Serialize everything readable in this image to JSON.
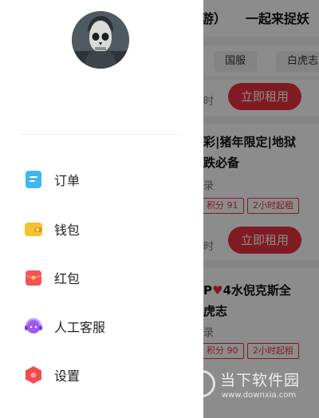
{
  "background": {
    "top_left_fragment": "游）",
    "top_right_title": "一起来捉妖",
    "chips": [
      "国服",
      "白虎志"
    ],
    "cards": [
      {
        "price_suffix": "时",
        "rent_label": "立即租用"
      },
      {
        "title_line1": "彩|猪年限定|地狱",
        "title_line2": "跌必备",
        "subtitle": "录",
        "tag_points": "积分 91",
        "tag_duration": "2小时起租",
        "price_suffix": "时",
        "rent_label": "立即租用"
      },
      {
        "title_prefix": "P",
        "title_after_heart": "4水倪克斯全",
        "title_line2": "虎志",
        "subtitle": "录",
        "tag_points": "积分 90",
        "tag_duration": "2小时起租"
      }
    ]
  },
  "drawer": {
    "menu": [
      {
        "label": "订单",
        "icon": "order-icon",
        "color": "#3fb6f2"
      },
      {
        "label": "钱包",
        "icon": "wallet-icon",
        "color": "#f6c02e"
      },
      {
        "label": "红包",
        "icon": "red-packet-icon",
        "color": "#f25353"
      },
      {
        "label": "人工客服",
        "icon": "customer-service-icon",
        "color": "#9b5cf0"
      },
      {
        "label": "设置",
        "icon": "settings-icon",
        "color": "#f24b4b"
      }
    ]
  },
  "watermark": {
    "title": "当下软件园",
    "url": "www.downxia.com"
  }
}
